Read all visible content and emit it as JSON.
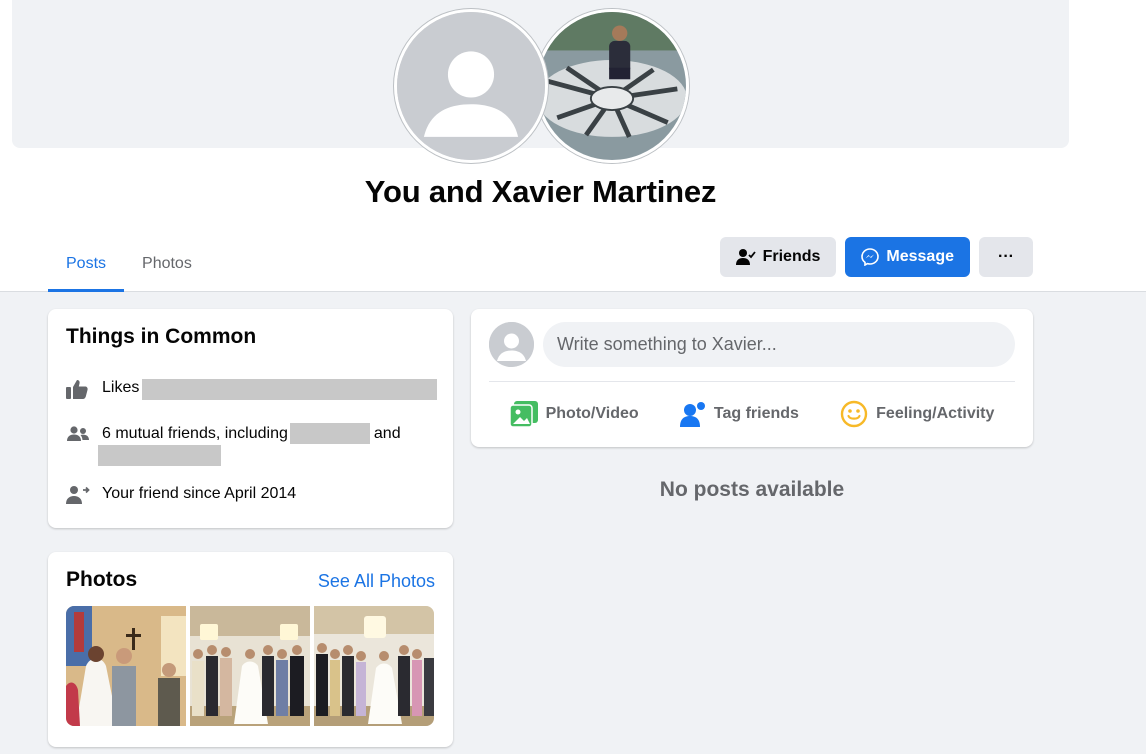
{
  "header": {
    "title": "You and Xavier Martinez"
  },
  "tabs": [
    {
      "label": "Posts",
      "active": true
    },
    {
      "label": "Photos",
      "active": false
    }
  ],
  "actions": {
    "friends_label": "Friends",
    "message_label": "Message",
    "more_label": "···"
  },
  "things_in_common": {
    "title": "Things in Common",
    "likes_label": "Likes",
    "mutual_prefix": "6 mutual friends, including",
    "mutual_and": "and",
    "friend_since": "Your friend since April 2014"
  },
  "photos": {
    "title": "Photos",
    "see_all": "See All Photos",
    "count": 3
  },
  "composer": {
    "placeholder": "Write something to Xavier...",
    "photo_video": "Photo/Video",
    "tag_friends": "Tag friends",
    "feeling": "Feeling/Activity"
  },
  "feed": {
    "empty_message": "No posts available"
  },
  "colors": {
    "accent": "#1b74e4",
    "photo_green": "#45bd62",
    "feeling_yellow": "#f7b928",
    "secondary_text": "#65676b",
    "page_background": "#f0f2f5"
  },
  "icons": {
    "likes": "thumbs-up-icon",
    "mutual": "people-icon",
    "friend_since": "friend-arrow-icon",
    "friends_button": "person-check-icon",
    "message_button": "messenger-icon",
    "more_button": "ellipsis-icon"
  }
}
